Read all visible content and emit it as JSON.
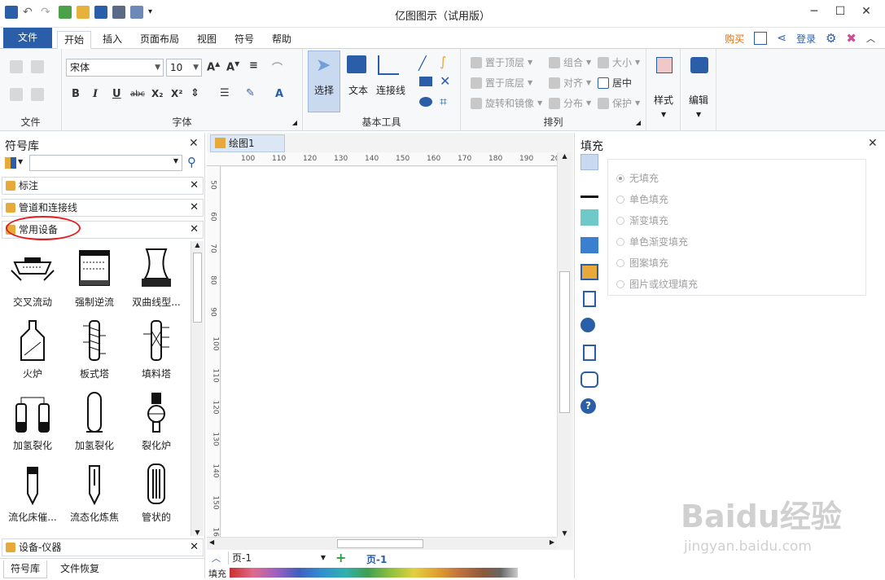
{
  "app": {
    "title": "亿图图示（试用版）"
  },
  "ribbon_tabs": {
    "file": "文件",
    "home": "开始",
    "insert": "插入",
    "page_layout": "页面布局",
    "view": "视图",
    "symbol": "符号",
    "help": "帮助"
  },
  "header_right": {
    "buy": "购买",
    "login": "登录"
  },
  "file_group": {
    "label": "文件"
  },
  "font_group": {
    "label": "字体",
    "font_name": "宋体",
    "font_size": "10",
    "bold": "B",
    "italic": "I",
    "underline": "U",
    "strike": "abc",
    "sub": "X₂",
    "sup": "X²",
    "font_a": "A"
  },
  "basic_tools": {
    "label": "基本工具",
    "select": "选择",
    "text": "文本",
    "connector": "连接线"
  },
  "arrange": {
    "label": "排列",
    "bring_front": "置于顶层",
    "send_back": "置于底层",
    "rotate_mirror": "旋转和镜像",
    "group": "组合",
    "align": "对齐",
    "distribute": "分布",
    "size": "大小",
    "center": "居中",
    "protect": "保护"
  },
  "style_group": {
    "label": "样式"
  },
  "edit_group": {
    "label": "编辑"
  },
  "library": {
    "title": "符号库",
    "sections": [
      "标注",
      "管道和连接线",
      "常用设备"
    ],
    "bottom_section": "设备-仪器",
    "shapes": [
      "交叉流动",
      "强制逆流",
      "双曲线型...",
      "火炉",
      "板式塔",
      "填料塔",
      "加氢裂化",
      "加氢裂化",
      "裂化炉",
      "流化床催...",
      "流态化炼焦",
      "管状的"
    ],
    "bottom_tabs": [
      "符号库",
      "文件恢复"
    ]
  },
  "document": {
    "tab": "绘图1",
    "ruler_h": [
      "100",
      "110",
      "120",
      "130",
      "140",
      "150",
      "160",
      "170",
      "180",
      "190",
      "200"
    ],
    "ruler_v": [
      "50",
      "60",
      "70",
      "80",
      "90",
      "100",
      "110",
      "120",
      "130",
      "140",
      "150",
      "160"
    ],
    "page_select": "页-1",
    "page_tab": "页-1",
    "fill_label": "填充"
  },
  "fill_panel": {
    "title": "填充",
    "options": [
      "无填充",
      "单色填充",
      "渐变填充",
      "单色渐变填充",
      "图案填充",
      "图片或纹理填充"
    ]
  },
  "watermark": {
    "brand": "Baidu经验",
    "url": "jingyan.baidu.com"
  }
}
